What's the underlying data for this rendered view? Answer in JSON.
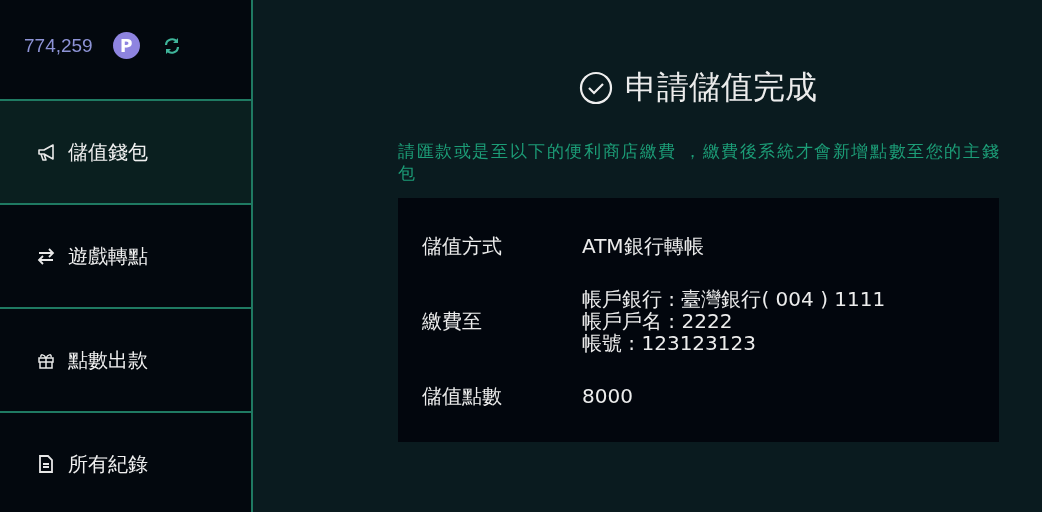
{
  "wallet": {
    "balance": "774,259",
    "currency": "P"
  },
  "sidebar": {
    "items": [
      {
        "kind": "megaphone",
        "label": "儲值錢包",
        "selected": true
      },
      {
        "kind": "transfer",
        "label": "遊戲轉點",
        "selected": false
      },
      {
        "kind": "gift",
        "label": "點數出款",
        "selected": false
      },
      {
        "kind": "document",
        "label": "所有紀錄",
        "selected": false
      }
    ]
  },
  "result": {
    "title": "申請儲值完成",
    "notice": "請匯款或是至以下的便利商店繳費 ，繳費後系統才會新增點數至您的主錢包",
    "rows": [
      {
        "label": "儲值方式",
        "lines": [
          "ATM銀行轉帳"
        ]
      },
      {
        "label": "繳費至",
        "lines": [
          "帳戶銀行 : 臺灣銀行( 004 ) 1111",
          "帳戶戶名 : 2222",
          "帳號 : 123123123"
        ]
      },
      {
        "label": "儲值點數",
        "lines": [
          "8000"
        ]
      }
    ]
  }
}
